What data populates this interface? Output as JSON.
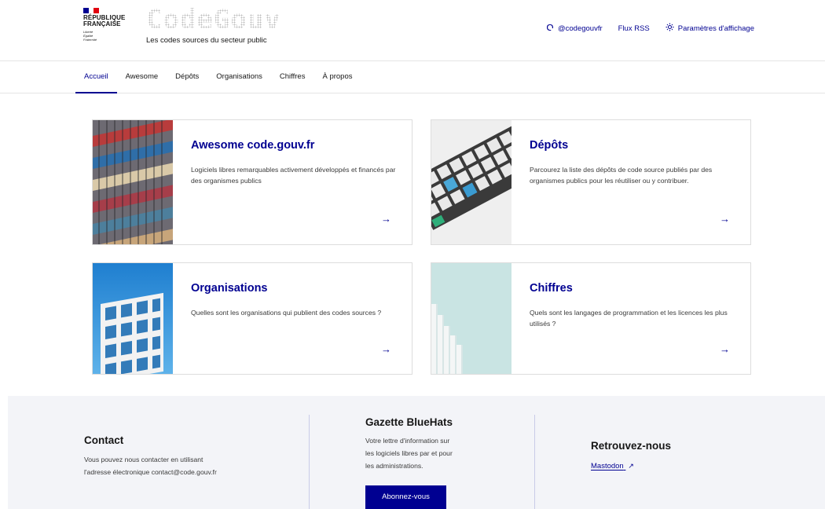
{
  "header": {
    "rf_line1": "RÉPUBLIQUE",
    "rf_line2": "FRANÇAISE",
    "motto_1": "Liberté",
    "motto_2": "Égalité",
    "motto_3": "Fraternité",
    "logo_text": "CodeGouv",
    "tagline": "Les codes sources du secteur public",
    "tools": [
      {
        "icon": "mastodon-icon",
        "label": "@codegouvfr"
      },
      {
        "icon": "",
        "label": "Flux RSS"
      },
      {
        "icon": "sun-icon",
        "label": "Paramètres d'affichage"
      }
    ]
  },
  "nav": {
    "items": [
      "Accueil",
      "Awesome",
      "Dépôts",
      "Organisations",
      "Chiffres",
      "À propos"
    ],
    "active": "Accueil"
  },
  "cards": [
    {
      "title": "Awesome code.gouv.fr",
      "desc": "Logiciels libres remarquables activement développés et financés par des organismes publics",
      "arrow": "→"
    },
    {
      "title": "Dépôts",
      "desc": "Parcourez la liste des dépôts de code source publiés par des organismes publics pour les réutiliser ou y contribuer.",
      "arrow": "→"
    },
    {
      "title": "Organisations",
      "desc": "Quelles sont les organisations qui publient des codes sources ?",
      "arrow": "→"
    },
    {
      "title": "Chiffres",
      "desc": "Quels sont les langages de programmation et les licences les plus utilisés ?",
      "arrow": "→"
    }
  ],
  "footer": {
    "contact_title": "Contact",
    "contact_line1": "Vous pouvez nous contacter en utilisant",
    "contact_line2": "l'adresse électronique contact@code.gouv.fr",
    "gazette_title": "Gazette BlueHats",
    "gazette_line1": "Votre lettre d'information sur",
    "gazette_line2": "les logiciels libres par et pour",
    "gazette_line3": "les administrations.",
    "subscribe_label": "Abonnez-vous",
    "find_title": "Retrouvez-nous",
    "mastodon_label": "Mastodon"
  },
  "colors": {
    "primary": "#000091",
    "footer_bg": "#f3f4f8",
    "flag_blue": "#000091",
    "flag_red": "#e1000f"
  }
}
